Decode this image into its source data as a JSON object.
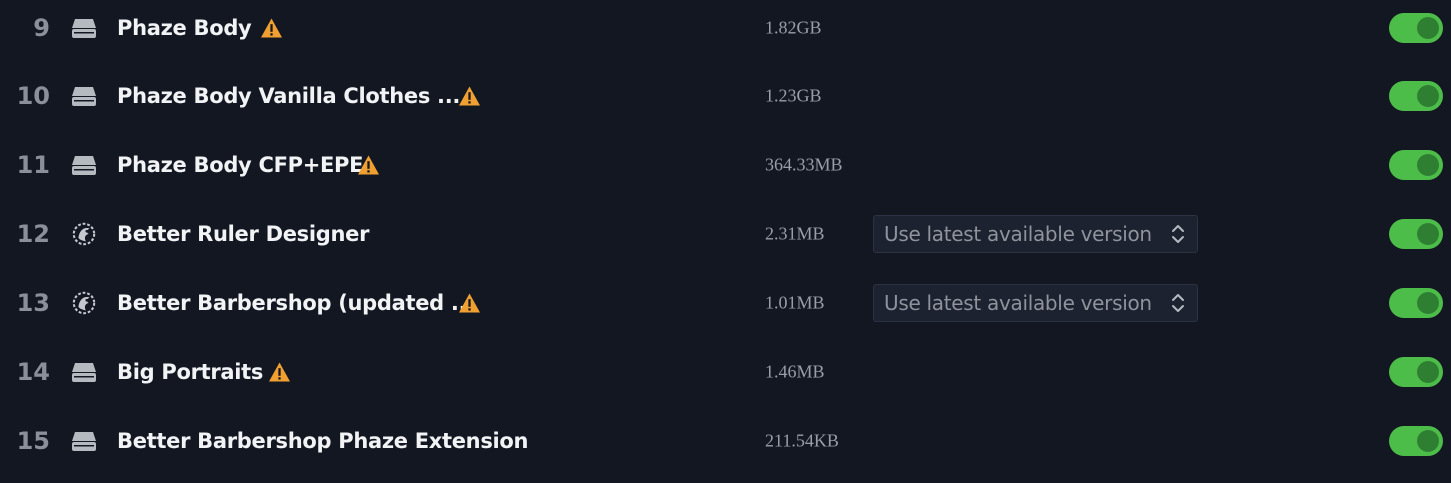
{
  "colors": {
    "background": "#131722",
    "toggle_on": "#4dbd4a",
    "warning": "#f0a030"
  },
  "mods": [
    {
      "index": "9",
      "name": "Phaze Body",
      "size": "1.82GB",
      "source_icon": "drive-icon",
      "warning": true,
      "version": null,
      "enabled": true
    },
    {
      "index": "10",
      "name": "Phaze Body Vanilla Clothes ...",
      "size": "1.23GB",
      "source_icon": "drive-icon",
      "warning": true,
      "version": null,
      "enabled": true
    },
    {
      "index": "11",
      "name": "Phaze Body CFP+EPE",
      "size": "364.33MB",
      "source_icon": "drive-icon",
      "warning": true,
      "version": null,
      "enabled": true
    },
    {
      "index": "12",
      "name": "Better Ruler Designer",
      "size": "2.31MB",
      "source_icon": "workshop-icon",
      "warning": false,
      "version": "Use latest available version",
      "enabled": true
    },
    {
      "index": "13",
      "name": "Better Barbershop (updated ...",
      "size": "1.01MB",
      "source_icon": "workshop-icon",
      "warning": true,
      "version": "Use latest available version",
      "enabled": true
    },
    {
      "index": "14",
      "name": "Big Portraits",
      "size": "1.46MB",
      "source_icon": "drive-icon",
      "warning": true,
      "version": null,
      "enabled": true
    },
    {
      "index": "15",
      "name": "Better Barbershop Phaze Extension",
      "size": "211.54KB",
      "source_icon": "drive-icon",
      "warning": false,
      "version": null,
      "enabled": true
    }
  ]
}
